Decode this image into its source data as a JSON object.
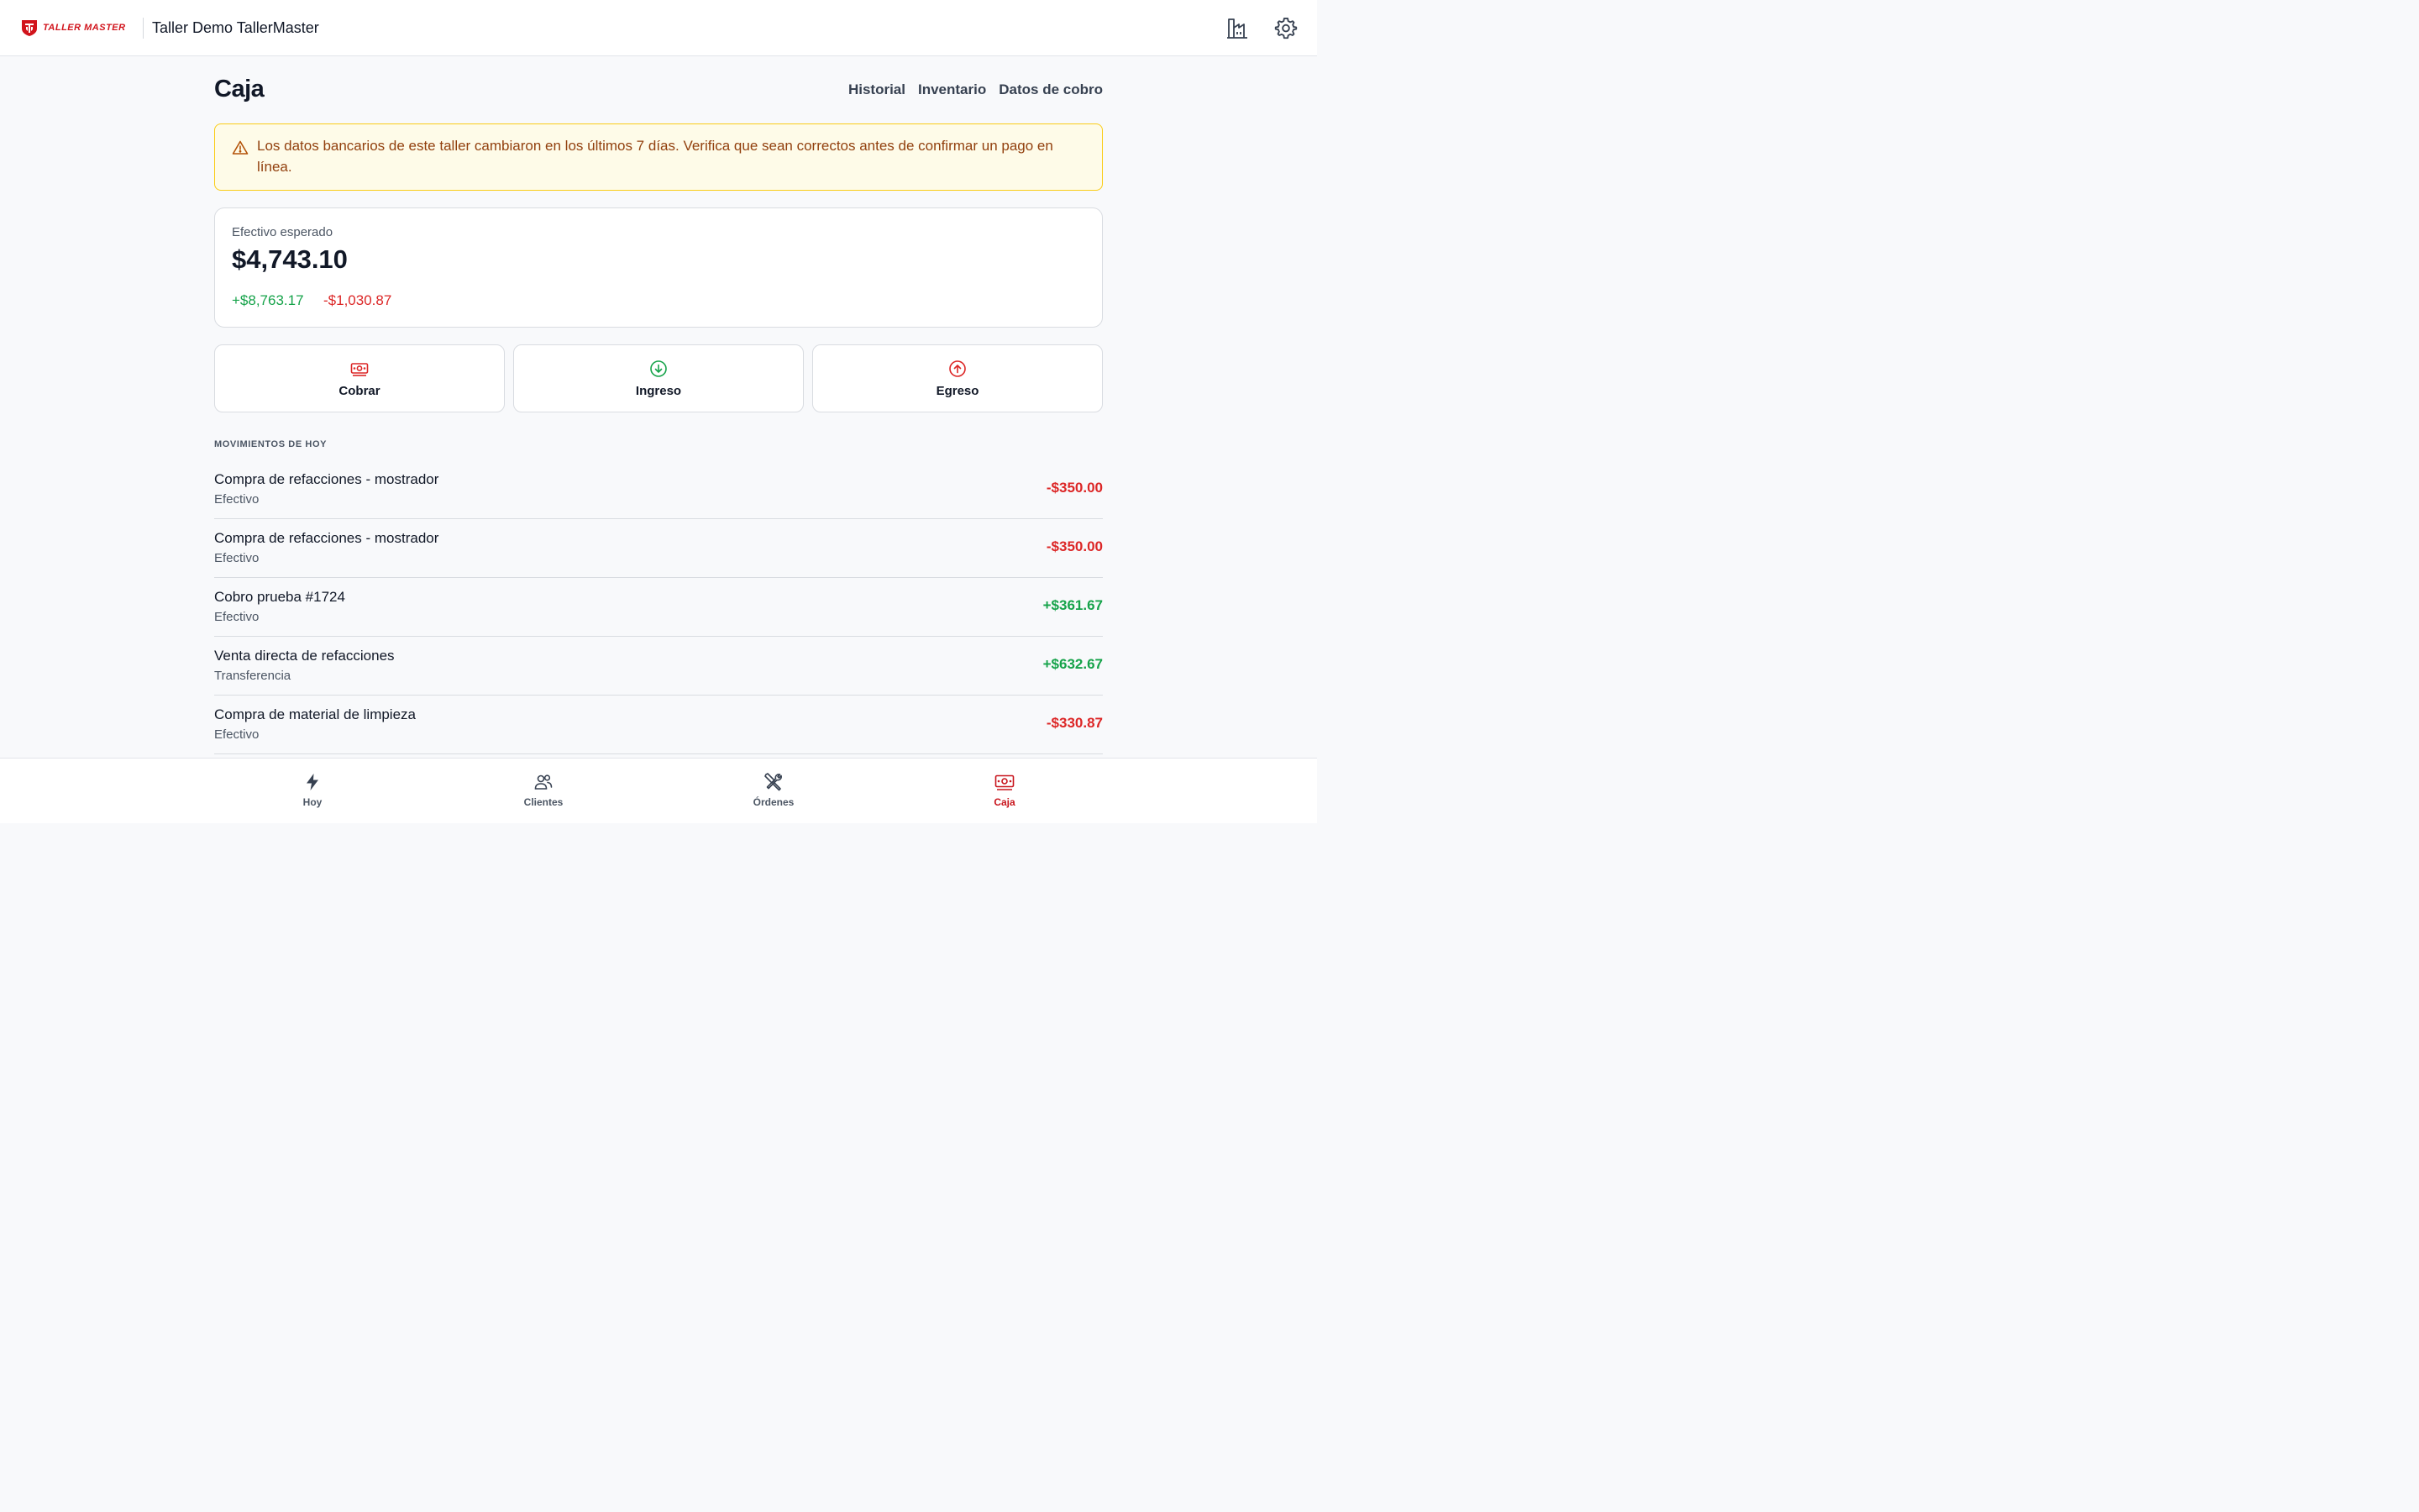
{
  "header": {
    "logo_text": "TALLER MASTER",
    "shop_name": "Taller Demo TallerMaster",
    "icons": [
      "building-icon",
      "gear-icon"
    ]
  },
  "page": {
    "title": "Caja",
    "links": [
      "Historial",
      "Inventario",
      "Datos de cobro"
    ]
  },
  "alert": {
    "text": "Los datos bancarios de este taller cambiaron en los últimos 7 días. Verifica que sean correctos antes de confirmar un pago en línea.",
    "icon": "warning-icon"
  },
  "cash": {
    "label": "Efectivo esperado",
    "amount": "$4,743.10",
    "income": "+$8,763.17",
    "expense": "-$1,030.87"
  },
  "actions": [
    {
      "label": "Cobrar",
      "icon": "cash-icon",
      "color": "#dc2626"
    },
    {
      "label": "Ingreso",
      "icon": "arrow-down-circle-icon",
      "color": "#16a34a"
    },
    {
      "label": "Egreso",
      "icon": "arrow-up-circle-icon",
      "color": "#dc2626"
    }
  ],
  "movements": {
    "section_title": "MOVIMIENTOS DE HOY",
    "items": [
      {
        "title": "Compra de refacciones - mostrador",
        "method": "Efectivo",
        "amount": "-$350.00",
        "sign": "neg"
      },
      {
        "title": "Compra de refacciones - mostrador",
        "method": "Efectivo",
        "amount": "-$350.00",
        "sign": "neg"
      },
      {
        "title": "Cobro prueba #1724",
        "method": "Efectivo",
        "amount": "+$361.67",
        "sign": "pos"
      },
      {
        "title": "Venta directa de refacciones",
        "method": "Transferencia",
        "amount": "+$632.67",
        "sign": "pos"
      },
      {
        "title": "Compra de material de limpieza",
        "method": "Efectivo",
        "amount": "-$330.87",
        "sign": "neg"
      }
    ]
  },
  "nav": {
    "items": [
      {
        "label": "Hoy",
        "icon": "lightning-icon",
        "active": false
      },
      {
        "label": "Clientes",
        "icon": "users-icon",
        "active": false
      },
      {
        "label": "Órdenes",
        "icon": "tools-icon",
        "active": false
      },
      {
        "label": "Caja",
        "icon": "cash-icon",
        "active": true
      }
    ]
  },
  "colors": {
    "brand": "#c8141c",
    "positive": "#16a34a",
    "negative": "#dc2626",
    "alert_bg": "#fefbe8",
    "alert_border": "#facc15"
  }
}
